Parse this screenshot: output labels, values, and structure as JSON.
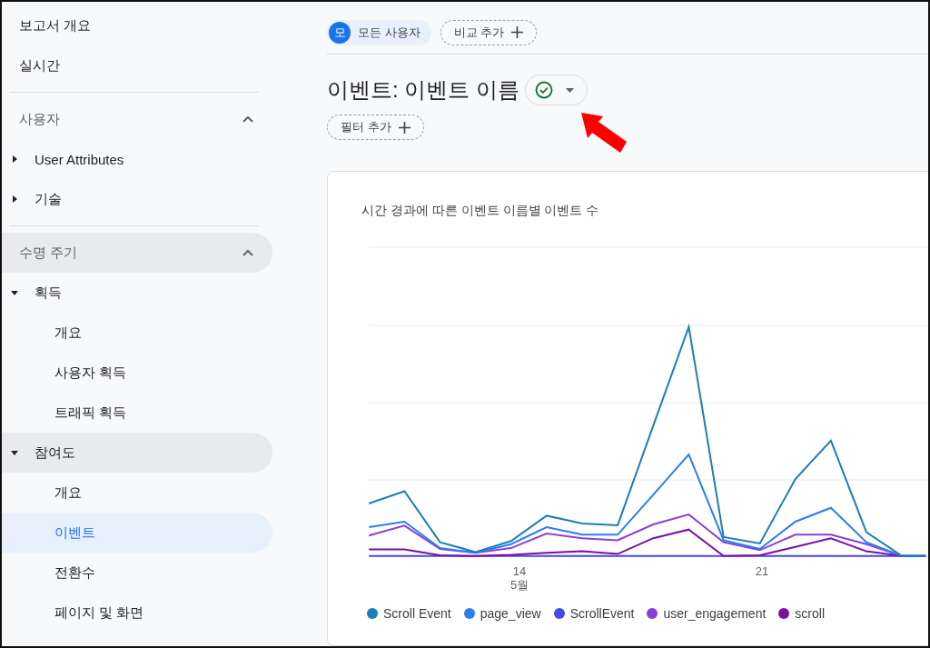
{
  "sidebar": {
    "top_items": [
      {
        "label": "보고서 개요",
        "selected": false
      },
      {
        "label": "실시간",
        "selected": false
      }
    ],
    "sections": [
      {
        "label": "사용자",
        "expanded": true,
        "highlighted": false,
        "groups": [
          {
            "label": "User Attributes",
            "expanded": false,
            "highlighted": false
          },
          {
            "label": "기술",
            "expanded": false,
            "highlighted": false
          }
        ]
      },
      {
        "label": "수명 주기",
        "expanded": true,
        "highlighted": true,
        "groups": [
          {
            "label": "획득",
            "expanded": true,
            "highlighted": false,
            "children": [
              {
                "label": "개요",
                "selected": false
              },
              {
                "label": "사용자 획득",
                "selected": false
              },
              {
                "label": "트래픽 획득",
                "selected": false
              }
            ]
          },
          {
            "label": "참여도",
            "expanded": true,
            "highlighted": true,
            "children": [
              {
                "label": "개요",
                "selected": false
              },
              {
                "label": "이벤트",
                "selected": true
              },
              {
                "label": "전환수",
                "selected": false
              },
              {
                "label": "페이지 및 화면",
                "selected": false
              }
            ]
          }
        ]
      }
    ]
  },
  "comparison_bar": {
    "segment": {
      "avatar": "모",
      "label": "모든 사용자"
    },
    "add_comparison": "비교 추가"
  },
  "header": {
    "title": "이벤트: 이벤트 이름",
    "verified": true,
    "add_filter": "필터 추가"
  },
  "chart_card": {
    "title": "시간 경과에 따른 이벤트 이름별 이벤트 수",
    "x_labels": [
      {
        "day": "14",
        "month": "5월"
      },
      {
        "day": "21"
      }
    ],
    "legend": [
      {
        "label": "Scroll Event",
        "color": "#1a7fb5"
      },
      {
        "label": "page_view",
        "color": "#2a7ef0"
      },
      {
        "label": "ScrollEvent",
        "color": "#4b47e6"
      },
      {
        "label": "user_engagement",
        "color": "#8a3fdc"
      },
      {
        "label": "scroll",
        "color": "#7a0ea6"
      }
    ]
  }
}
